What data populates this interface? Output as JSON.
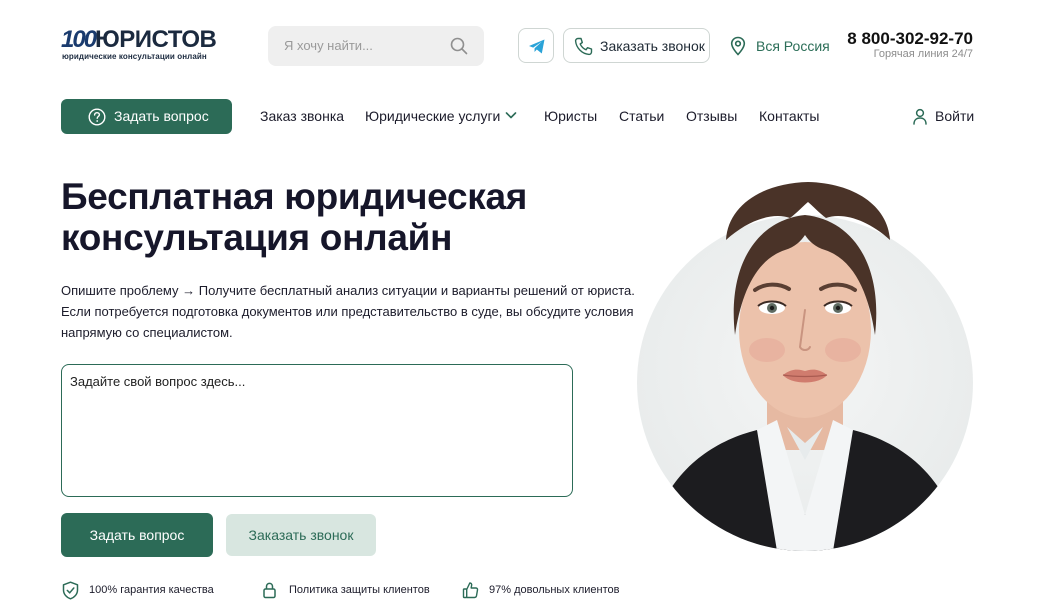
{
  "header": {
    "logo_number": "100",
    "logo_word": "ЮРИСТОВ",
    "logo_tagline": "юридические консультации онлайн",
    "search_placeholder": "Я хочу найти...",
    "call_button_label": "Заказать звонок",
    "region_label": "Вся Россия",
    "phone": "8 800-302-92-70",
    "hotline_label": "Горячая линия 24/7"
  },
  "nav": {
    "ask_button_label": "Задать вопрос",
    "items": [
      "Заказ звонка",
      "Юридические услуги",
      "Юристы",
      "Статьи",
      "Отзывы",
      "Контакты"
    ],
    "login_label": "Войти"
  },
  "hero": {
    "title": "Бесплатная юридическая консультация онлайн",
    "description": "Опишите проблему → Получите бесплатный анализ ситуации и варианты решений от юриста. Если потребуется подготовка документов или представительство в суде, вы обсудите условия напрямую со специалистом.",
    "question_placeholder": "Задайте свой вопрос здесь...",
    "ask_button_label": "Задать вопрос",
    "call_button_label": "Заказать звонок"
  },
  "features": [
    {
      "icon": "shield-check-icon",
      "label": "100% гарантия качества"
    },
    {
      "icon": "lock-icon",
      "label": "Политика защиты клиентов"
    },
    {
      "icon": "thumbs-up-icon",
      "label": "97% довольных клиентов"
    }
  ],
  "colors": {
    "brand_green": "#2c6b57",
    "light_green": "#d8e6e0",
    "title_dark": "#16162a"
  }
}
